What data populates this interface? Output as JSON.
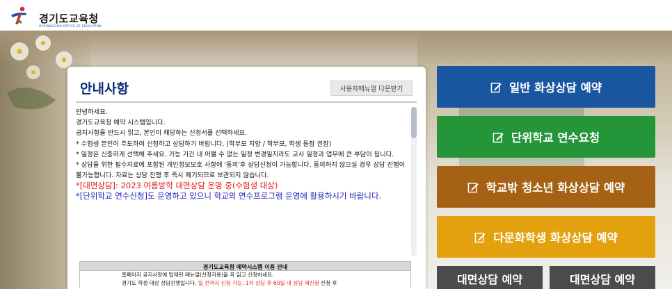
{
  "header": {
    "logo_name": "경기도교육청",
    "logo_sub": "GYEONGGIDO OFFICE OF EDUCATION"
  },
  "panel": {
    "title": "안내사항",
    "manual_button": "사용자매뉴얼 다운받기",
    "lines": [
      "안녕하세요.",
      "경기도교육청 예약 시스템입니다.",
      "공지사항을 반드시 읽고, 본인이 해당하는 신청서를 선택하세요.",
      "* 수험생 본인이 주도하여 신청하고 상담하기 바랍니다. (학부모 지양 / 학부모, 학생 동참 권장)",
      "* 일정은 신중하게 선택해 주세요. 가능 기간 내 어쩔 수 없는 일정 변경일지라도 교사 일정과 업무에 큰 부담이 됩니다.",
      "* 상담을 위한 필수자료에 포함된 개인정보보호 사항에 '동의'후 상담신청이 가능합니다. 동의하지 않으실 경우 상담 진행이 불가능합니다. 자료는 상담 진행 후 즉시 폐기되므로 보관되지 않습니다."
    ],
    "red_line": "*[대면상담]: 2023 여름방학 대면상담 운영 중(수험생 대상)",
    "blue_line": "*[단위학교 연수신청]도 운영하고 있으니 학교의 연수프로그램 운영에 활용하시기 바랍니다.",
    "table_title": "경기도교육청 예약시스템 이용 안내",
    "table_row1": "홈페이지 공지사항에 탑재된 매뉴얼(신청자용)을 꼭 읽고 신청하세요.",
    "table_row2_a": "경기도 학생 대상 상담진행입니다.",
    "table_row2_red": "일 전까지 신청 가능, 1차 상담 후 60일 내 상담 재신청",
    "table_row2_b": "신청 후"
  },
  "actions": [
    {
      "label": "일반 화상상담 예약"
    },
    {
      "label": "단위학교 연수요청"
    },
    {
      "label": "학교밖 청소년 화상상담 예약"
    },
    {
      "label": "다문화학생 화상상담 예약"
    },
    {
      "label": "대면상담 예약"
    },
    {
      "label": "대면상담 예약"
    }
  ],
  "colors": {
    "action_blue": "#1a56a0",
    "action_green": "#25953a",
    "action_brown": "#a66214",
    "action_yellow": "#e2a10d",
    "action_gray": "#4b4b4b",
    "title_navy": "#0d2d73",
    "notice_red": "#e21d1d",
    "notice_blue": "#2323c2"
  },
  "icons": {
    "logo": "running-figure-logo-icon",
    "action": "edit-note-icon"
  }
}
